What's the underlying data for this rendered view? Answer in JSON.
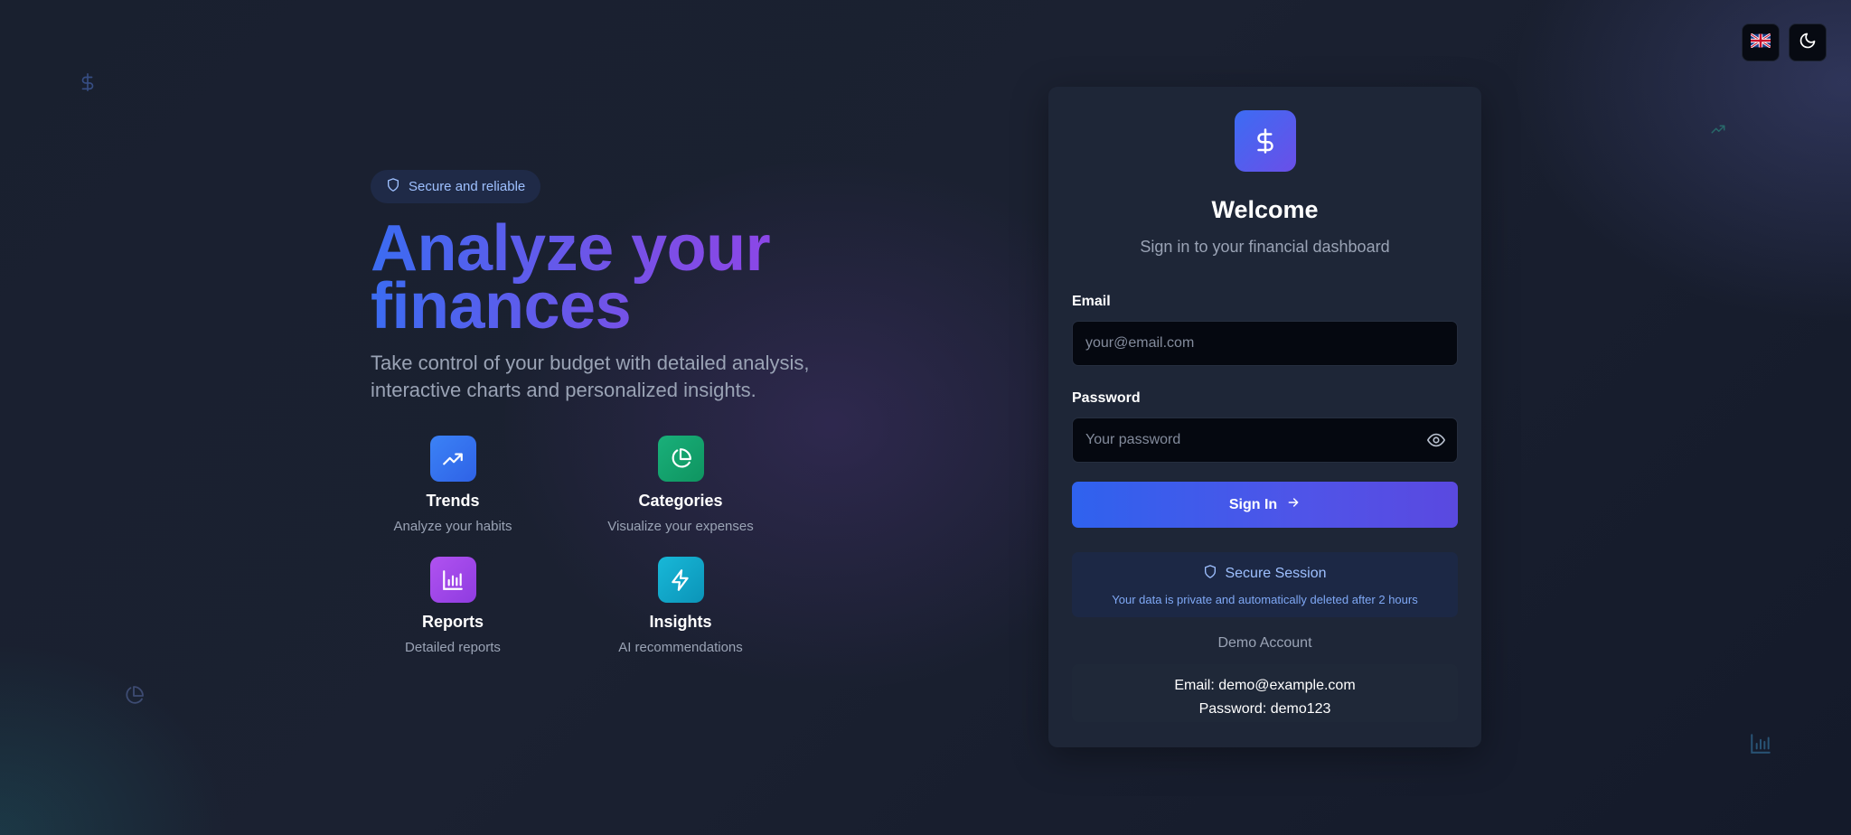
{
  "colors": {
    "accent_blue": "#3b6cf2",
    "accent_purple": "#9b3fe8",
    "trends_icon_bg": "#3b78f0",
    "categories_icon_bg": "#16a06a",
    "reports_icon_bg": "#a146ea",
    "insights_icon_bg": "#0fa8c8"
  },
  "top_controls": {
    "language_icon": "uk-flag-icon",
    "theme_icon": "moon-icon"
  },
  "hero": {
    "badge_icon": "shield-icon",
    "badge_label": "Secure and reliable",
    "title_line1": "Analyze your",
    "title_line2": "finances",
    "subtitle": "Take control of your budget with detailed analysis, interactive charts and personalized insights.",
    "features": [
      {
        "icon": "trending-up-icon",
        "title": "Trends",
        "description": "Analyze your habits"
      },
      {
        "icon": "pie-chart-icon",
        "title": "Categories",
        "description": "Visualize your expenses"
      },
      {
        "icon": "bar-chart-icon",
        "title": "Reports",
        "description": "Detailed reports"
      },
      {
        "icon": "lightning-icon",
        "title": "Insights",
        "description": "AI recommendations"
      }
    ]
  },
  "login": {
    "logo_icon": "dollar-icon",
    "title": "Welcome",
    "subtitle": "Sign in to your financial dashboard",
    "email_label": "Email",
    "email_value": "",
    "email_placeholder": "your@email.com",
    "password_label": "Password",
    "password_value": "",
    "password_placeholder": "Your password",
    "submit_label": "Sign In",
    "secure_title": "Secure Session",
    "secure_text": "Your data is private and automatically deleted after 2 hours",
    "demo_title": "Demo Account",
    "demo_email": "Email: demo@example.com",
    "demo_password": "Password: demo123"
  }
}
